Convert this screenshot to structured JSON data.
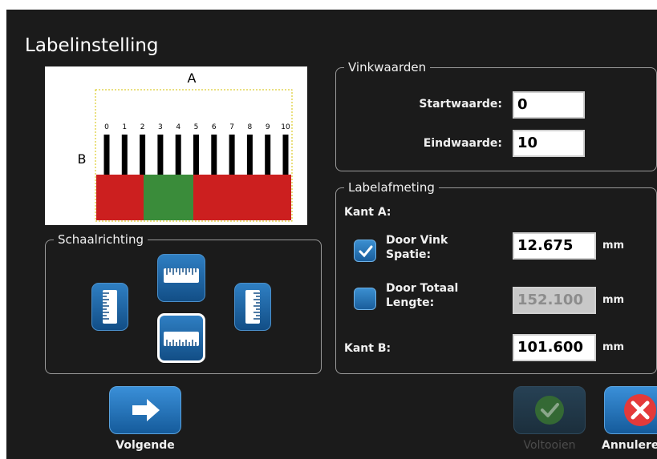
{
  "dialog": {
    "title": "Labelinstelling"
  },
  "preview": {
    "label_a": "A",
    "label_b": "B",
    "ticks": [
      "0",
      "1",
      "2",
      "3",
      "4",
      "5",
      "6",
      "7",
      "8",
      "9",
      "10"
    ],
    "colors": {
      "red": "#cc1f1f",
      "green": "#3a8c3a"
    }
  },
  "vinkwaarden": {
    "legend": "Vinkwaarden",
    "start_label": "Startwaarde:",
    "start_value": "0",
    "end_label": "Eindwaarde:",
    "end_value": "10"
  },
  "labelafmeting": {
    "legend": "Labelafmeting",
    "kant_a_label": "Kant A:",
    "door_vink_label_1": "Door Vink",
    "door_vink_label_2": "Spatie:",
    "door_vink_checked": true,
    "door_vink_value": "12.675",
    "door_totaal_label_1": "Door Totaal",
    "door_totaal_label_2": "Lengte:",
    "door_totaal_checked": false,
    "door_totaal_value": "152.100",
    "kant_b_label": "Kant B:",
    "kant_b_value": "101.600",
    "unit": "mm"
  },
  "schaalrichting": {
    "legend": "Schaalrichting",
    "options": [
      "ruler-vertical-left-icon",
      "ruler-horizontal-top-icon",
      "ruler-vertical-right-icon",
      "ruler-horizontal-bottom-icon"
    ],
    "selected": "ruler-horizontal-bottom-icon"
  },
  "footer": {
    "next_label": "Volgende",
    "finish_label": "Voltooien",
    "cancel_label": "Annuleren"
  },
  "colors": {
    "accent": "#1a6bb0",
    "background": "#1b1b1b"
  }
}
